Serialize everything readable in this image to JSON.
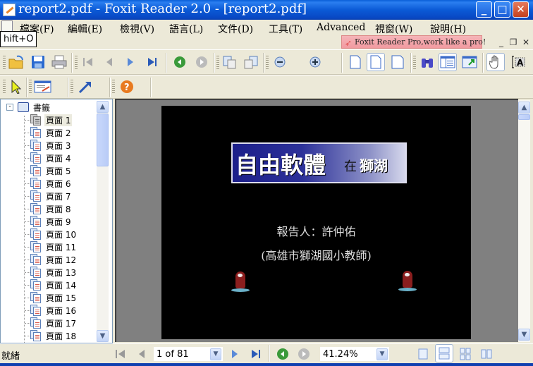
{
  "window": {
    "title": "report2.pdf - Foxit Reader 2.0 - [report2.pdf]",
    "minimize": "_",
    "maximize": "□",
    "close": "✕"
  },
  "menu": {
    "items": [
      {
        "label": "檔案(F)"
      },
      {
        "label": "編輯(E)"
      },
      {
        "label": "檢視(V)"
      },
      {
        "label": "語言(L)"
      },
      {
        "label": "文件(D)"
      },
      {
        "label": "工具(T)"
      },
      {
        "label": "Advanced"
      },
      {
        "label": "視窗(W)"
      },
      {
        "label": "說明(H)"
      }
    ],
    "promo": "Foxit Reader Pro,work like a pro!",
    "mdi_minimize": "_",
    "mdi_restore": "❐",
    "mdi_close": "✕"
  },
  "tooltip": "hift+O",
  "toolbar1": {
    "icons": [
      "open-icon",
      "save-icon",
      "print-icon",
      "first-page-icon",
      "prev-page-icon",
      "next-page-icon",
      "last-page-icon",
      "back-icon",
      "forward-icon",
      "extract-page-icon",
      "insert-page-icon",
      "zoom-out-icon",
      "zoom-in-icon",
      "actual-size-icon",
      "fit-page-icon",
      "fit-width-icon",
      "find-icon",
      "bookmarks-panel-icon",
      "fullscreen-icon",
      "hand-tool-icon",
      "text-select-icon"
    ]
  },
  "toolbar2": {
    "icons": [
      "select-tool-icon",
      "annotation-icon",
      "arrow-tool-icon",
      "help-icon"
    ]
  },
  "bookmarks": {
    "root": "書籤",
    "items": [
      {
        "label": "頁面 1"
      },
      {
        "label": "頁面 2"
      },
      {
        "label": "頁面 3"
      },
      {
        "label": "頁面 4"
      },
      {
        "label": "頁面 5"
      },
      {
        "label": "頁面 6"
      },
      {
        "label": "頁面 7"
      },
      {
        "label": "頁面 8"
      },
      {
        "label": "頁面 9"
      },
      {
        "label": "頁面 10"
      },
      {
        "label": "頁面 11"
      },
      {
        "label": "頁面 12"
      },
      {
        "label": "頁面 13"
      },
      {
        "label": "頁面 14"
      },
      {
        "label": "頁面 15"
      },
      {
        "label": "頁面 16"
      },
      {
        "label": "頁面 17"
      },
      {
        "label": "頁面 18"
      }
    ],
    "selected_index": 0
  },
  "page": {
    "banner_title": "自由軟體",
    "banner_connector": "在",
    "banner_place": "獅湖",
    "presenter": "報告人：許仲佑",
    "affiliation": "(高雄市獅湖國小教師)"
  },
  "status": {
    "text": "就緒",
    "page_value": "1 of 81",
    "zoom_value": "41.24%"
  },
  "colors": {
    "titlebar": "#0a5fd8",
    "page_background": "#000000",
    "viewer_background": "#808080",
    "promo": "#f19aa0"
  }
}
